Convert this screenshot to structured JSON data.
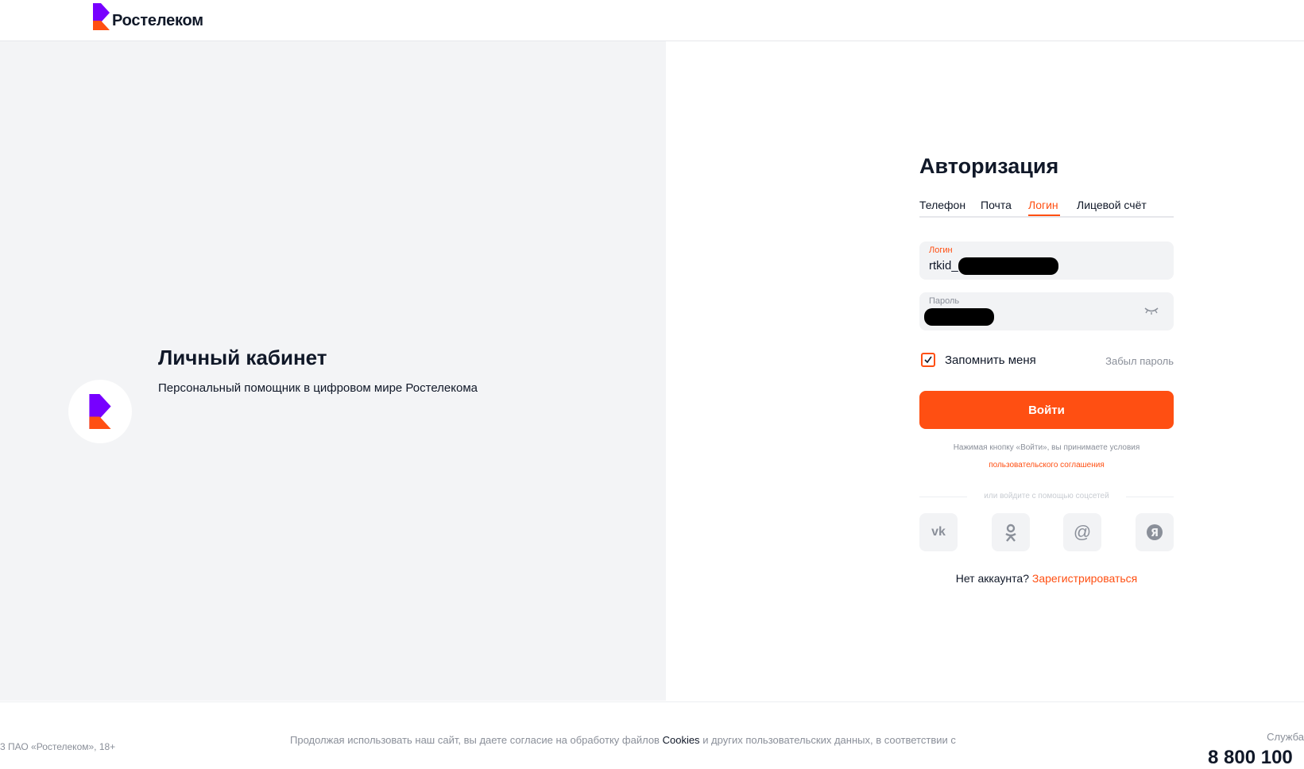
{
  "header": {
    "brand": "Ростелеком"
  },
  "promo": {
    "title": "Личный кабинет",
    "subtitle": "Персональный помощник в цифровом мире Ростелекома"
  },
  "auth": {
    "title": "Авторизация",
    "tabs": [
      {
        "label": "Телефон",
        "active": false
      },
      {
        "label": "Почта",
        "active": false
      },
      {
        "label": "Логин",
        "active": true
      },
      {
        "label": "Лицевой счёт",
        "active": false
      }
    ],
    "login_field": {
      "label": "Логин",
      "value": "rtkid_"
    },
    "password_field": {
      "label": "Пароль"
    },
    "remember_label": "Запомнить меня",
    "remember_checked": true,
    "forgot_label": "Забыл пароль",
    "submit_label": "Войти",
    "terms_text": "Нажимая кнопку «Войти», вы принимаете условия",
    "terms_link": "пользовательского соглашения",
    "social_divider": "или войдите с помощью соцсетей",
    "social": [
      "vk-icon",
      "ok-icon",
      "mail-at-icon",
      "yandex-icon"
    ],
    "no_account_text": "Нет аккаунта?",
    "register_link": "Зарегистрироваться"
  },
  "footer": {
    "copyright": "3 ПАО «Ростелеком», 18+",
    "cookie_text_pre": "Продолжая использовать наш сайт, вы даете согласие на обработку файлов",
    "cookie_word": "Cookies",
    "cookie_text_post": "и других пользовательских данных, в соответствии с",
    "service_label": "Служба",
    "phone": "8 800 100"
  },
  "colors": {
    "accent": "#ff4f12",
    "brand_purple": "#7700ff",
    "panel_bg": "#f3f4f6"
  }
}
